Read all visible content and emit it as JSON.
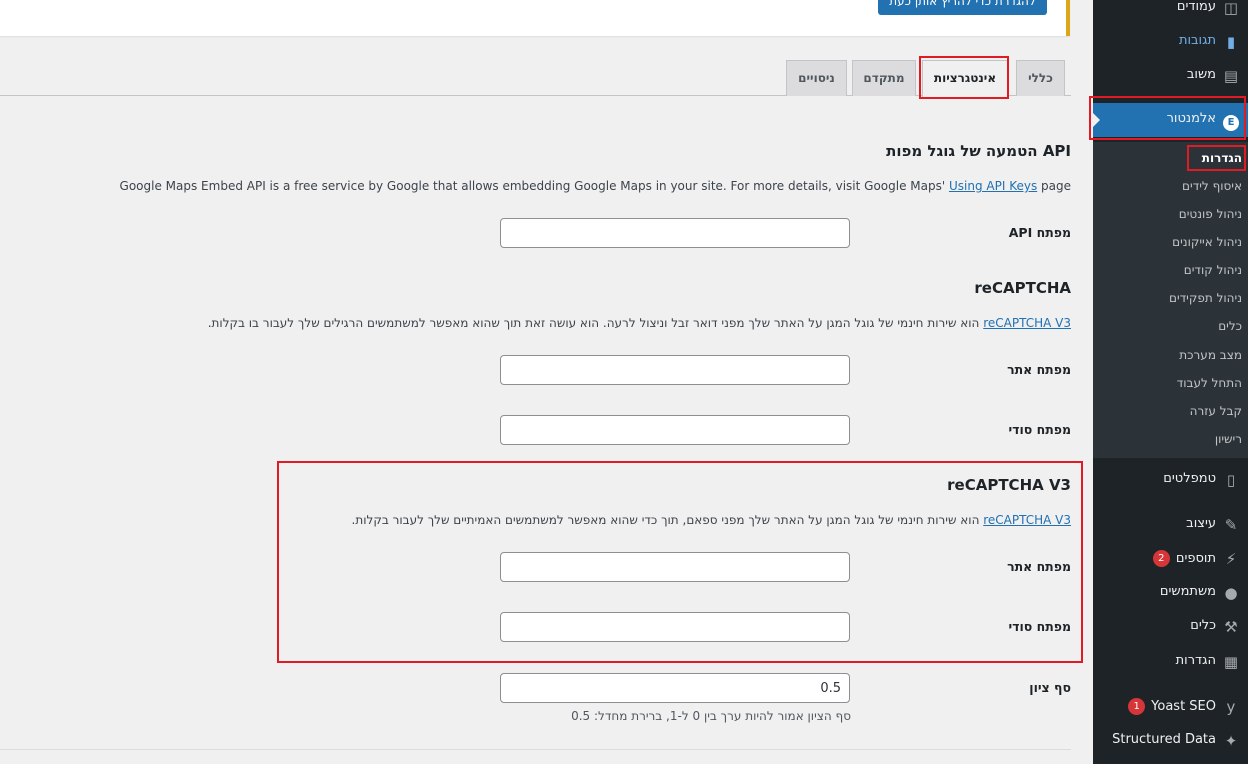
{
  "notice": {
    "button_label": "להגדרת כדי להריץ אותן כעת"
  },
  "tabs": [
    {
      "label": "כללי"
    },
    {
      "label": "אינטגרציות"
    },
    {
      "label": "מתקדם"
    },
    {
      "label": "ניסויים"
    }
  ],
  "gmaps": {
    "title": "API הטמעה של גוגל מפות",
    "desc_before": "Google Maps Embed API is a free service by Google that allows embedding Google Maps in your site. For more details, visit Google Maps' ",
    "desc_link": "Using API Keys",
    "desc_after": " page",
    "api_key_label": "מפתח API",
    "api_key_value": ""
  },
  "recaptcha": {
    "title": "reCAPTCHA",
    "desc_link": "reCAPTCHA V3",
    "desc_text": " הוא שירות חינמי של גוגל המגן על האתר שלך מפני דואר זבל וניצול לרעה. הוא עושה זאת תוך שהוא מאפשר למשתמשים הרגילים שלך לעבור בו בקלות.",
    "site_key_label": "מפתח אתר",
    "secret_key_label": "מפתח סודי"
  },
  "recaptcha_v3": {
    "title": "reCAPTCHA V3",
    "desc_link": "reCAPTCHA V3",
    "desc_text": " הוא שירות חינמי של גוגל המגן על האתר שלך מפני ספאם, תוך כדי שהוא מאפשר למשתמשים האמיתיים שלך לעבור בקלות.",
    "site_key_label": "מפתח אתר",
    "secret_key_label": "מפתח סודי"
  },
  "threshold": {
    "label": "סף ציון",
    "value": "0.5",
    "help": "סף הציון אמור להיות ערך בין 0 ל-1, ברירת מחדל: 0.5"
  },
  "sidebar": {
    "pages": "עמודים",
    "comments": "תגובות",
    "feedback": "משוב",
    "elementor": "אלמנטור",
    "submenu": [
      "הגדרות",
      "איסוף לידים",
      "ניהול פונטים",
      "ניהול אייקונים",
      "ניהול קודים",
      "ניהול תפקידים",
      "כלים",
      "מצב מערכת",
      "התחל לעבוד",
      "קבל עזרה",
      "רישיון"
    ],
    "templates": "טמפלטים",
    "appearance": "עיצוב",
    "plugins": "תוספים",
    "plugins_badge": "2",
    "users": "משתמשים",
    "tools": "כלים",
    "settings": "הגדרות",
    "yoast": "Yoast SEO",
    "yoast_badge": "1",
    "structured": "Structured Data"
  },
  "colors": {
    "accent": "#2271b1",
    "highlight": "#e01b24",
    "sidebar_bg": "#1d2327"
  }
}
